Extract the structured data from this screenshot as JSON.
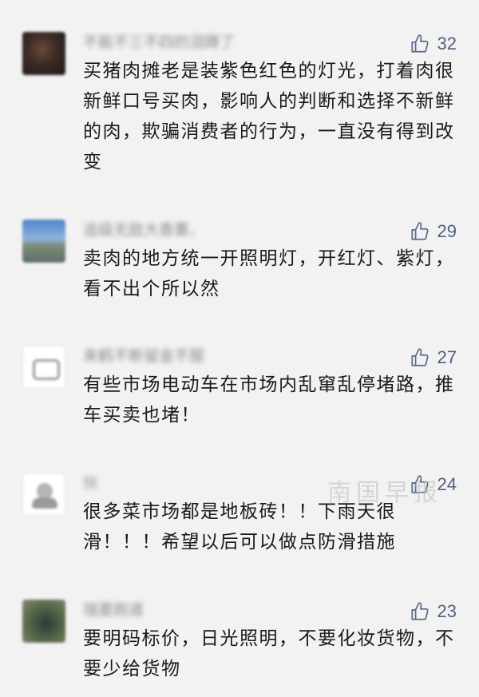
{
  "comments": [
    {
      "name": "不能不三不四的泪蹲了",
      "likes": "32",
      "text": "买猪肉摊老是装紫色红色的灯光，打着肉很新鲜口号买肉，影响人的判断和选择不新鲜的肉，欺骗消费者的行为，一直没有得到改变",
      "avatar_colors": [
        "#3b2a24",
        "#6a4a3a",
        "#1e1a1a"
      ]
    },
    {
      "name": "追级无敌大香薰、",
      "likes": "29",
      "text": "卖肉的地方统一开照明灯，开红灯、紫灯，看不出个所以然",
      "avatar_colors": [
        "#5b8fd0",
        "#9fb8d8",
        "#6f7f8f"
      ]
    },
    {
      "name": "来鹤不断留金不服",
      "likes": "27",
      "text": "有些市场电动车在市场内乱窜乱停堵路，推车买卖也堵！",
      "avatar_colors": [
        "#ffffff",
        "#d8d8d8",
        "#9a9a9a"
      ]
    },
    {
      "name": "伙",
      "likes": "24",
      "text": "很多菜市场都是地板砖！！下雨天很滑！！！希望以后可以做点防滑措施",
      "avatar_colors": [
        "#ffffff",
        "#cfcfcf",
        "#8a8a8a"
      ]
    },
    {
      "name": "瑞菱跑道",
      "likes": "23",
      "text": "要明码标价，日光照明，不要化妆货物，不要少给货物",
      "avatar_colors": [
        "#5a6a4a",
        "#2a3a3a",
        "#8a8a7a"
      ]
    }
  ],
  "watermark": "南国早报",
  "colors": {
    "background": "#f2f2f2",
    "text": "#1a1a1a",
    "like": "#4f5f82",
    "name": "#8c8c8c"
  }
}
